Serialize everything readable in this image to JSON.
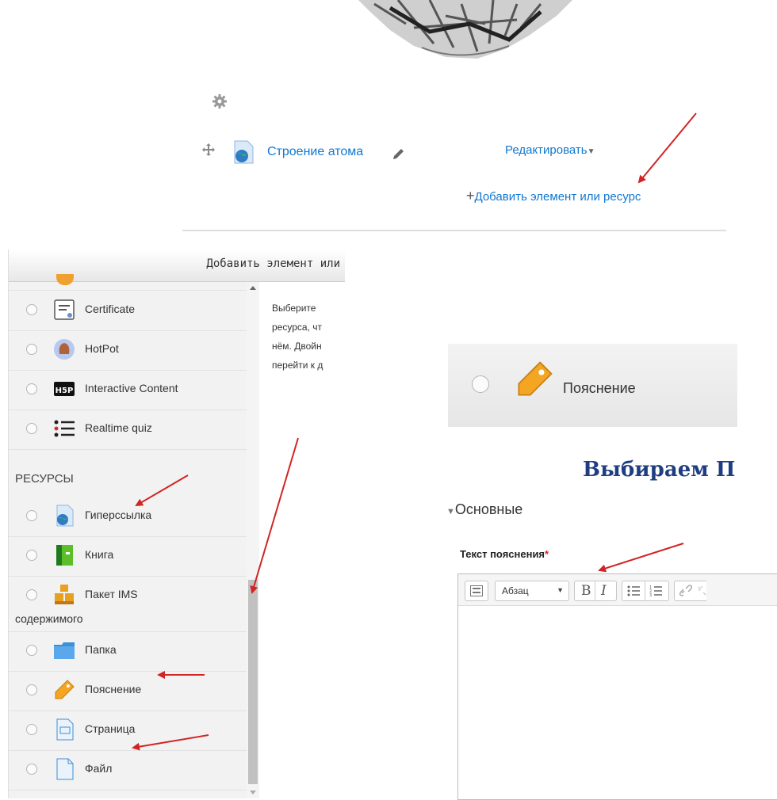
{
  "course": {
    "resource_name": "Строение атома",
    "edit_menu": "Редактировать",
    "add_link": "Добавить элемент или ресурс"
  },
  "chooser": {
    "title": "Добавить элемент или",
    "activities": [
      {
        "label": "Certificate",
        "icon": "certificate-icon"
      },
      {
        "label": "HotPot",
        "icon": "hotpot-icon"
      },
      {
        "label": "Interactive Content",
        "icon": "h5p-icon"
      },
      {
        "label": "Realtime quiz",
        "icon": "list-icon"
      }
    ],
    "resources_header": "РЕСУРСЫ",
    "resources": [
      {
        "label": "Гиперссылка",
        "icon": "url-icon"
      },
      {
        "label": "Книга",
        "icon": "book-icon"
      },
      {
        "label": "Пакет IMS",
        "label2": "содержимого",
        "icon": "ims-package-icon"
      },
      {
        "label": "Папка",
        "icon": "folder-icon"
      },
      {
        "label": "Пояснение",
        "icon": "label-tag-icon"
      },
      {
        "label": "Страница",
        "icon": "page-icon"
      },
      {
        "label": "Файл",
        "icon": "file-icon"
      }
    ],
    "description_lines": [
      "Выберите",
      "ресурса, чт",
      "нём. Двойн",
      "перейти к д"
    ]
  },
  "zoom_option": {
    "label": "Пояснение"
  },
  "heading": "Выбираем П",
  "form": {
    "section": "Основные",
    "field_label": "Текст пояснения",
    "required_mark": "*",
    "paragraph_select": "Абзац"
  },
  "colors": {
    "link": "#1177d1",
    "heading": "#1f3e82",
    "arrow": "#d22424",
    "required": "#d22424"
  }
}
